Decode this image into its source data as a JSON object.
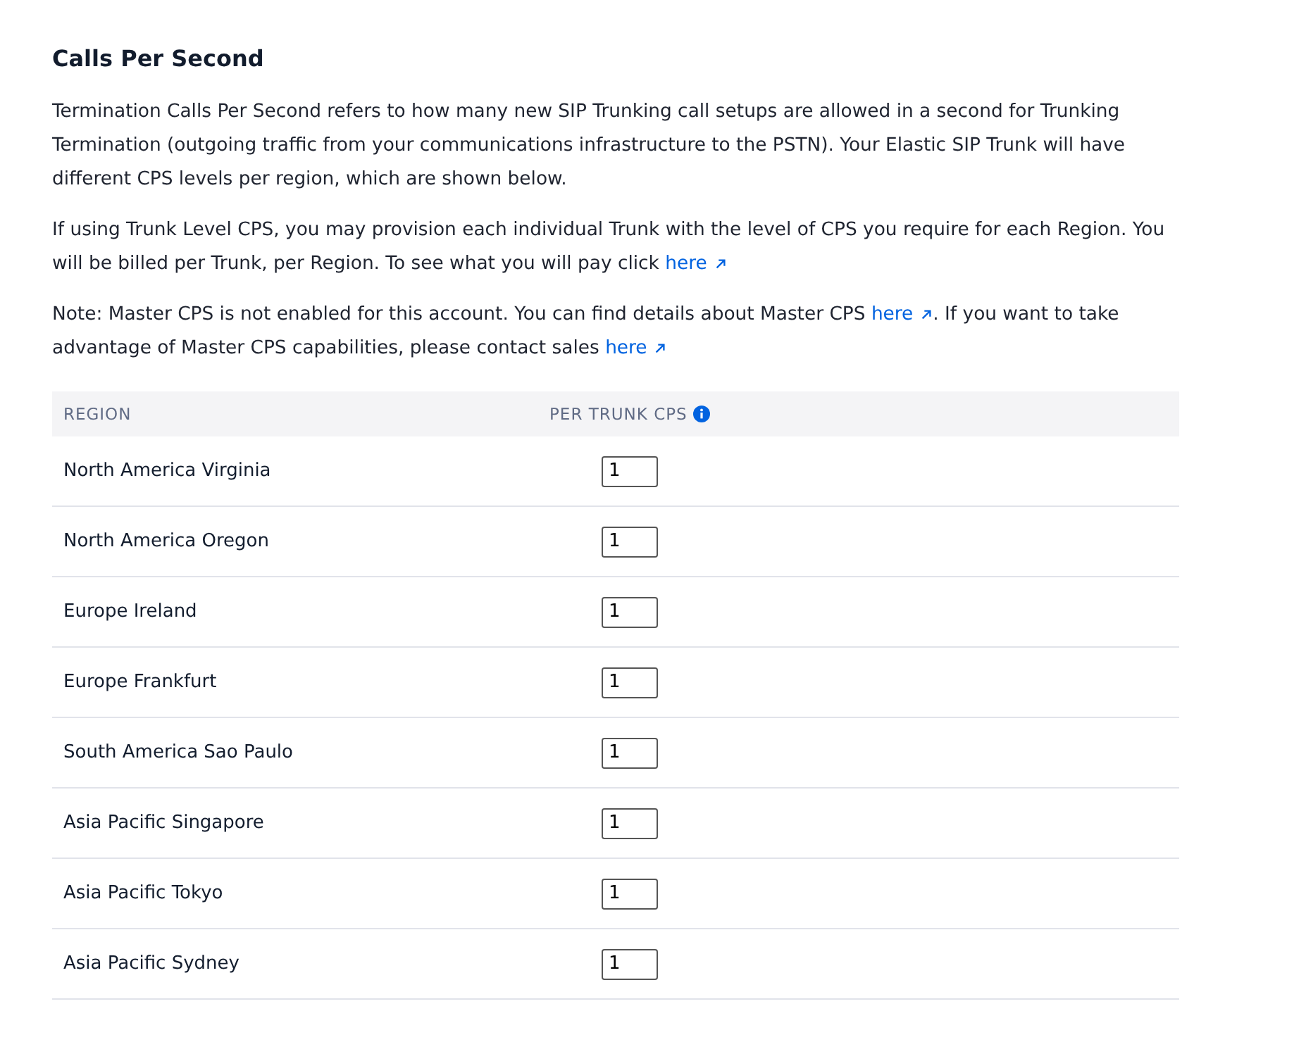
{
  "title": "Calls Per Second",
  "paragraphs": [
    [
      {
        "kind": "text",
        "text": "Termination Calls Per Second refers to how many new SIP Trunking call setups are allowed in a second for Trunking Termination (outgoing traffic from your communications infrastructure to the PSTN). Your Elastic SIP Trunk will have different CPS levels per region, which are shown below."
      }
    ],
    [
      {
        "kind": "text",
        "text": "If using Trunk Level CPS, you may provision each individual Trunk with the level of CPS you require for each Region. You will be billed per Trunk, per Region. To see what you will pay click "
      },
      {
        "kind": "link",
        "text": "here"
      }
    ],
    [
      {
        "kind": "text",
        "text": "Note: Master CPS is not enabled for this account. You can find details about Master CPS "
      },
      {
        "kind": "link",
        "text": "here"
      },
      {
        "kind": "text",
        "text": ". If you want to take advantage of Master CPS capabilities, please contact sales "
      },
      {
        "kind": "link",
        "text": "here"
      }
    ]
  ],
  "table": {
    "columns": [
      "REGION",
      "PER TRUNK CPS"
    ],
    "rows": [
      {
        "region": "North America Virginia",
        "cps": "1"
      },
      {
        "region": "North America Oregon",
        "cps": "1"
      },
      {
        "region": "Europe Ireland",
        "cps": "1"
      },
      {
        "region": "Europe Frankfurt",
        "cps": "1"
      },
      {
        "region": "South America Sao Paulo",
        "cps": "1"
      },
      {
        "region": "Asia Pacific Singapore",
        "cps": "1"
      },
      {
        "region": "Asia Pacific Tokyo",
        "cps": "1"
      },
      {
        "region": "Asia Pacific Sydney",
        "cps": "1"
      }
    ]
  }
}
